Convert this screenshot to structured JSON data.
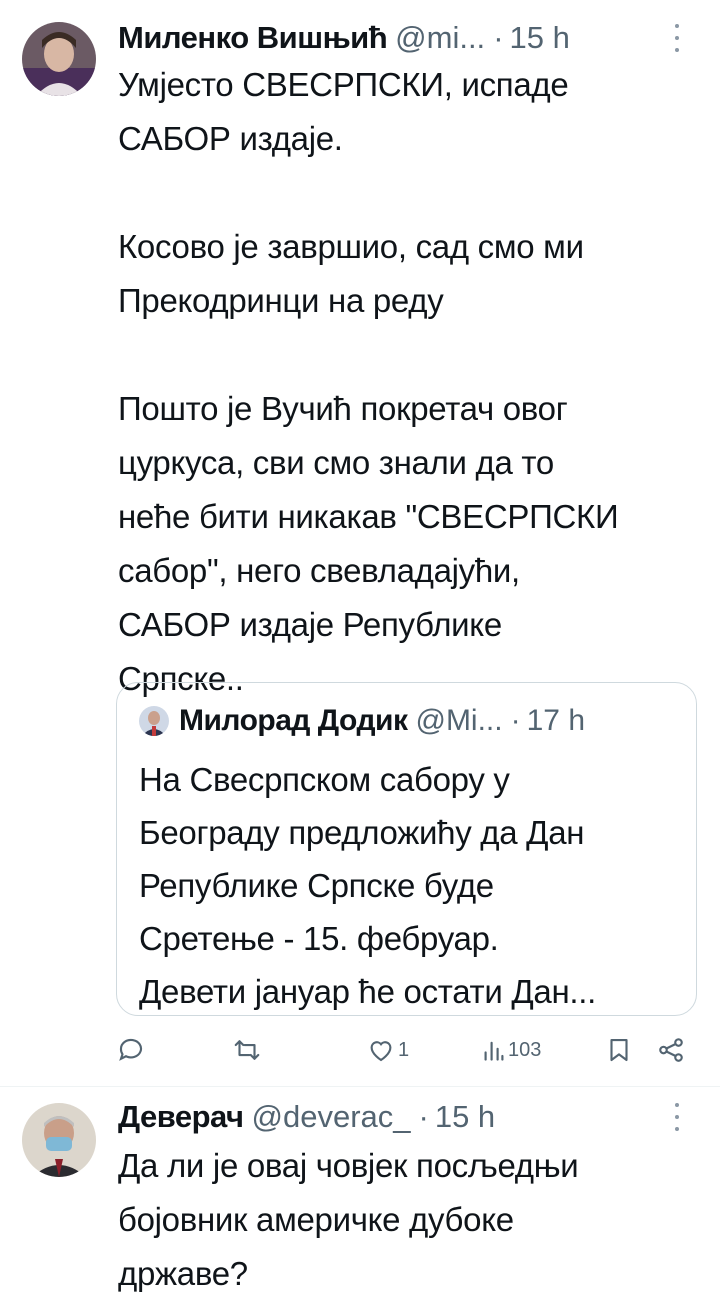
{
  "tweet1": {
    "author_name": "Миленко Вишњић",
    "handle": "@mi...",
    "time": "15 h",
    "text": "Умјесто СВЕСРПСКИ, испаде\nСАБОР издаје.\n\nКосово је завршио, сад смо ми\nПрекодринци на реду\n\nПошто је Вучић покретач овог\nцуркуса, сви смо знали да то\nнеће бити никакав \"СВЕСРПСКИ\nсабор\", него свевладајући,\nСАБОР издаје Републике\nСрпске..",
    "quoted": {
      "author_name": "Милорад Додик",
      "handle": "@Mi...",
      "time": "17 h",
      "text": "На Свесрпском сабору у\nБеограду предложићу да Дан\nРепублике Српске буде\nСретење - 15. фебруар.\nДевети јануар ће остати Дан..."
    },
    "actions": {
      "reply_icon": "reply-icon",
      "retweet_icon": "retweet-icon",
      "like_icon": "heart-icon",
      "like_count": "1",
      "views_icon": "views-icon",
      "views_count": "103",
      "bookmark_icon": "bookmark-icon",
      "share_icon": "share-icon"
    }
  },
  "tweet2": {
    "author_name": "Деверач",
    "handle": "@deverac_",
    "time": "15 h",
    "text": "Да ли је овај човјек посљедњи\nбојовник америчке дубоке\nдржаве?"
  },
  "colors": {
    "text": "#0f1419",
    "secondary": "#536471",
    "border": "#cfd9de"
  }
}
